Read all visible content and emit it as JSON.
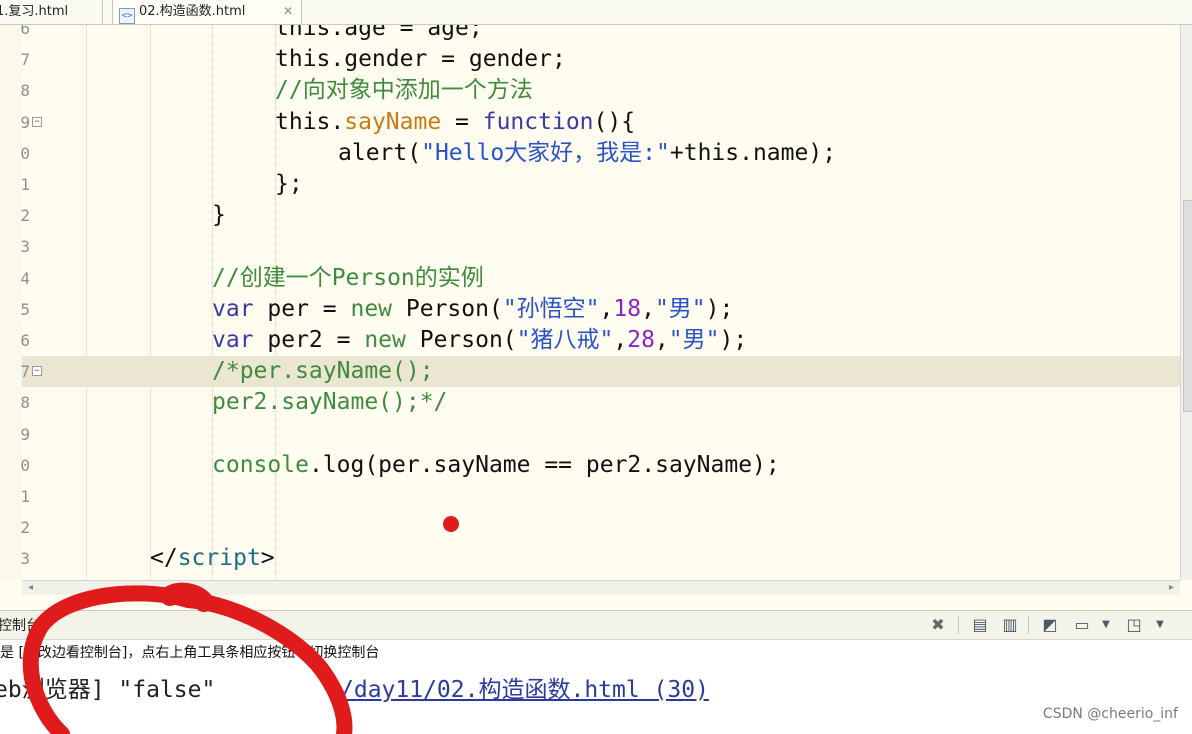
{
  "tabs": [
    {
      "label": "1.复习.html"
    },
    {
      "label": "02.构造函数.html",
      "active": true
    }
  ],
  "editor": {
    "lines": [
      {
        "number": "6",
        "fold": "",
        "segments": [
          {
            "t": "this.age = age;",
            "c": ""
          }
        ]
      },
      {
        "number": "7",
        "fold": "",
        "segments": [
          {
            "t": "this.gender = gender;",
            "c": ""
          }
        ]
      },
      {
        "number": "8",
        "fold": "",
        "segments": [
          {
            "t": "//向对象中添加一个方法",
            "c": "cm"
          }
        ]
      },
      {
        "number": "9",
        "fold": "−",
        "segments": [
          {
            "t": "this.",
            "c": ""
          },
          {
            "t": "sayName",
            "c": "fn"
          },
          {
            "t": " = ",
            "c": ""
          },
          {
            "t": "function",
            "c": "kw"
          },
          {
            "t": "(){",
            "c": ""
          }
        ]
      },
      {
        "number": "0",
        "fold": "",
        "segments": [
          {
            "t": "alert(",
            "c": ""
          },
          {
            "t": "\"Hello大家好，我是:\"",
            "c": "str"
          },
          {
            "t": "+this.name);",
            "c": ""
          }
        ]
      },
      {
        "number": "1",
        "fold": "",
        "segments": [
          {
            "t": "};",
            "c": ""
          }
        ]
      },
      {
        "number": "2",
        "fold": "",
        "segments": [
          {
            "t": "}",
            "c": ""
          }
        ]
      },
      {
        "number": "3",
        "fold": "",
        "segments": []
      },
      {
        "number": "4",
        "fold": "",
        "segments": [
          {
            "t": "//创建一个Person的实例",
            "c": "cm"
          }
        ]
      },
      {
        "number": "5",
        "fold": "",
        "segments": [
          {
            "t": "var",
            "c": "kw"
          },
          {
            "t": " per = ",
            "c": ""
          },
          {
            "t": "new",
            "c": "cm"
          },
          {
            "t": " Person(",
            "c": ""
          },
          {
            "t": "\"孙悟空\"",
            "c": "str"
          },
          {
            "t": ",",
            "c": ""
          },
          {
            "t": "18",
            "c": "num"
          },
          {
            "t": ",",
            "c": ""
          },
          {
            "t": "\"男\"",
            "c": "str"
          },
          {
            "t": ");",
            "c": ""
          }
        ]
      },
      {
        "number": "6",
        "fold": "",
        "segments": [
          {
            "t": "var",
            "c": "kw"
          },
          {
            "t": " per2 = ",
            "c": ""
          },
          {
            "t": "new",
            "c": "cm"
          },
          {
            "t": " Person(",
            "c": ""
          },
          {
            "t": "\"猪八戒\"",
            "c": "str"
          },
          {
            "t": ",",
            "c": ""
          },
          {
            "t": "28",
            "c": "num"
          },
          {
            "t": ",",
            "c": ""
          },
          {
            "t": "\"男\"",
            "c": "str"
          },
          {
            "t": ");",
            "c": ""
          }
        ]
      },
      {
        "number": "7",
        "fold": "−",
        "highlight": true,
        "segments": [
          {
            "t": "/*per.sayName();",
            "c": "cm"
          }
        ]
      },
      {
        "number": "8",
        "fold": "",
        "segments": [
          {
            "t": "per2.sayName();*/",
            "c": "cm"
          }
        ]
      },
      {
        "number": "9",
        "fold": "",
        "segments": []
      },
      {
        "number": "0",
        "fold": "",
        "segments": [
          {
            "t": "console",
            "c": "cm"
          },
          {
            "t": ".log(per.sayName == per2.sayName);",
            "c": ""
          }
        ]
      },
      {
        "number": "1",
        "fold": "",
        "segments": []
      },
      {
        "number": "2",
        "fold": "",
        "segments": []
      },
      {
        "number": "3",
        "fold": "",
        "segments": [
          {
            "t": "</",
            "c": ""
          },
          {
            "t": "script",
            "c": "tag"
          },
          {
            "t": ">",
            "c": ""
          }
        ]
      }
    ]
  },
  "console": {
    "title": "控制台",
    "info": "是 [边改边看控制台]，点右上角工具条相应按钮可切换控制台",
    "output": "eb浏览器] \"false\"",
    "link": "/day11/02.构造函数.html (30)"
  },
  "watermark": "CSDN @cheerio_inf",
  "colors": {
    "annotation": "#e01b1b",
    "editor_bg": "#fffdf0",
    "highlight_line": "#ebe6d1"
  }
}
